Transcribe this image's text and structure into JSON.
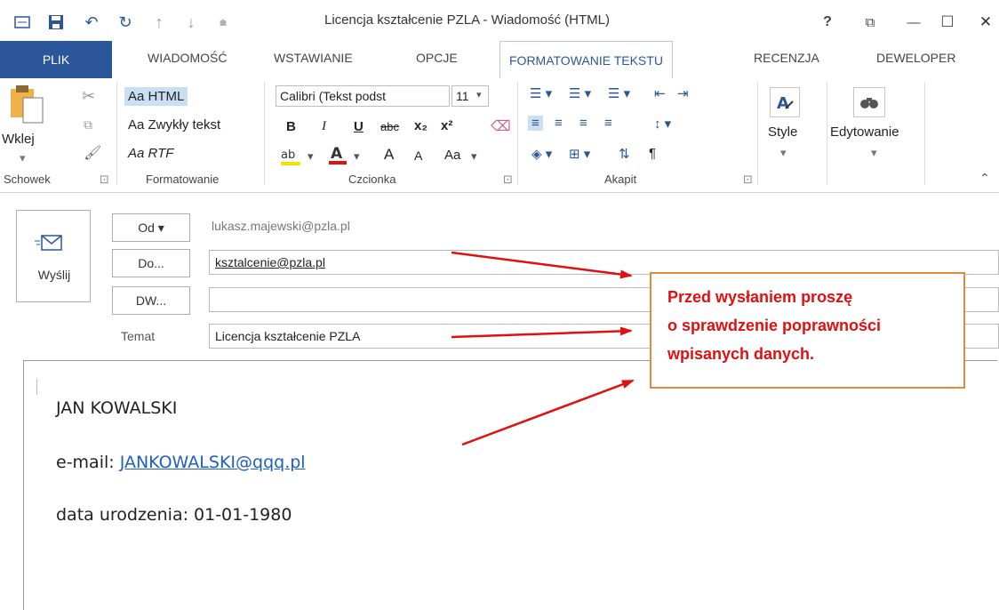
{
  "window": {
    "title": "Licencja kształcenie PZLA - Wiadomość (HTML)",
    "help": "?",
    "restore": "⧉",
    "minimize": "—",
    "maximize": "☐",
    "close": "✕"
  },
  "tabs": [
    {
      "label": "PLIK"
    },
    {
      "label": "WIADOMOŚĆ"
    },
    {
      "label": "WSTAWIANIE"
    },
    {
      "label": "OPCJE"
    },
    {
      "label": "FORMATOWANIE TEKSTU"
    },
    {
      "label": "RECENZJA"
    },
    {
      "label": "DEWELOPER"
    }
  ],
  "ribbon": {
    "clipboard": {
      "paste": "Wklej",
      "group": "Schowek"
    },
    "format": {
      "html": "Aa HTML",
      "plain": "Aa Zwykły tekst",
      "rtf": "Aa RTF",
      "group": "Formatowanie"
    },
    "font": {
      "name": "Calibri (Tekst podst",
      "size": "11",
      "bold": "B",
      "italic": "I",
      "underline": "U",
      "strike": "abc",
      "sub": "x₂",
      "sup": "x²",
      "grow": "A",
      "shrink": "A",
      "case": "Aa",
      "group": "Czcionka"
    },
    "paragraph": {
      "group": "Akapit",
      "pilcrow": "¶"
    },
    "styles": {
      "label": "Style"
    },
    "editing": {
      "label": "Edytowanie"
    }
  },
  "compose": {
    "send": "Wyślij",
    "from_btn": "Od ▾",
    "from_value": "lukasz.majewski@pzla.pl",
    "to_btn": "Do...",
    "to_value": "ksztalcenie@pzla.pl",
    "cc_btn": "DW...",
    "cc_value": "",
    "subject_label": "Temat",
    "subject_value": "Licencja kształcenie PZLA"
  },
  "message": {
    "name": "JAN KOWALSKI",
    "email_label": "e-mail: ",
    "email_link": "JANKOWALSKI@qqq.pl",
    "birth": "data urodzenia: 01-01-1980"
  },
  "annotation": {
    "line1": "Przed wysłaniem proszę",
    "line2": "o sprawdzenie poprawności",
    "line3": "wpisanych danych."
  },
  "colors": {
    "accent": "#2b579a",
    "annotation_text": "#e01010",
    "annotation_border": "#e38a3d",
    "arrow": "#e01010",
    "link": "#1f5fbf"
  }
}
